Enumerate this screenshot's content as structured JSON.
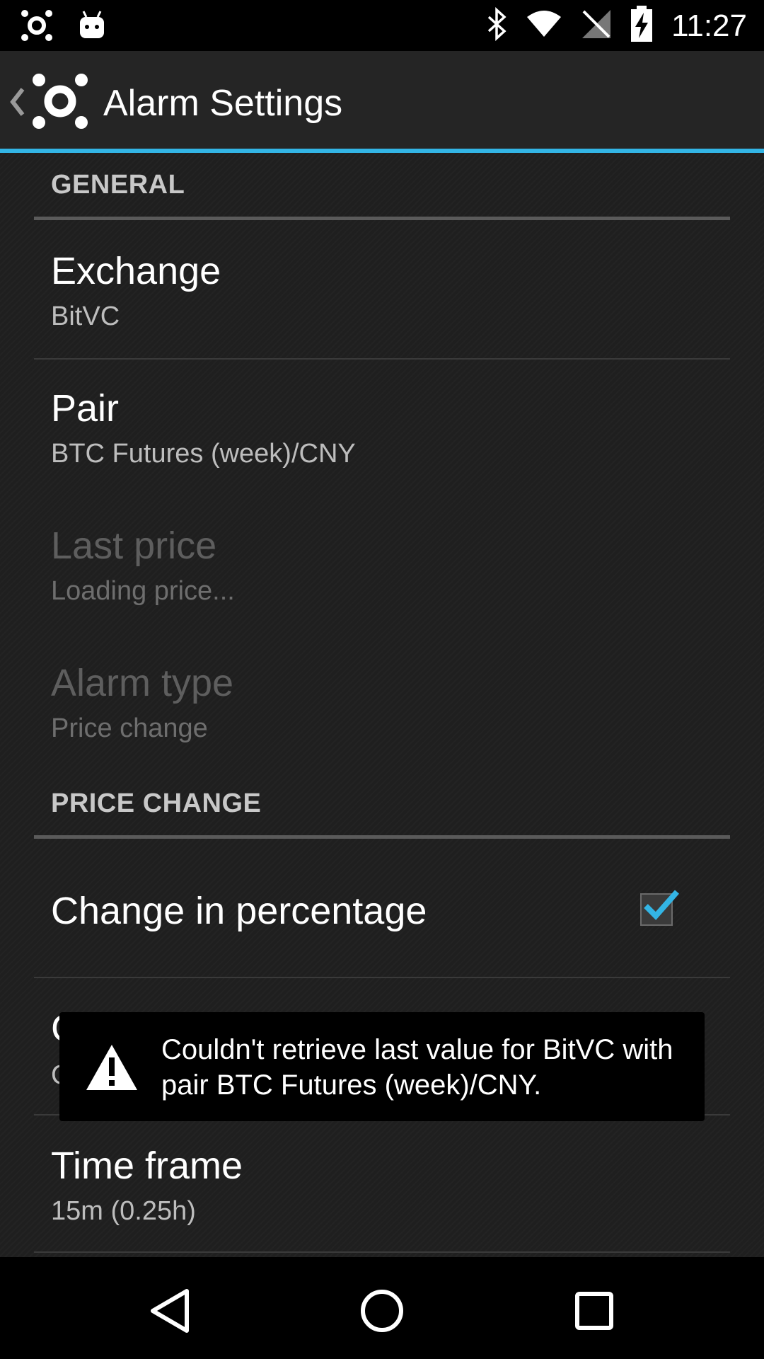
{
  "status_bar": {
    "time": "11:27",
    "icons": [
      "app-notification-icon",
      "android-debug-icon",
      "bluetooth-icon",
      "wifi-icon",
      "no-sim-icon",
      "battery-charging-icon"
    ]
  },
  "action_bar": {
    "title": "Alarm Settings",
    "back_icon": "chevron-left-icon",
    "app_icon": "app-logo-icon",
    "accent_color": "#33b5e5"
  },
  "sections": {
    "general": {
      "header": "GENERAL",
      "items": [
        {
          "title": "Exchange",
          "summary": "BitVC",
          "enabled": true
        },
        {
          "title": "Pair",
          "summary": "BTC Futures (week)/CNY",
          "enabled": true
        },
        {
          "title": "Last price",
          "summary": "Loading price...",
          "enabled": false
        },
        {
          "title": "Alarm type",
          "summary": "Price change",
          "enabled": false
        }
      ]
    },
    "price_change": {
      "header": "PRICE CHANGE",
      "items": [
        {
          "title": "Change in percentage",
          "checked": true
        },
        {
          "title": "C",
          "summary": "C"
        },
        {
          "title": "Time frame",
          "summary": "15m (0.25h)"
        }
      ]
    }
  },
  "toast": {
    "icon": "warning-icon",
    "message": "Couldn't retrieve last value for BitVC with pair BTC Futures (week)/CNY."
  },
  "nav_bar": {
    "buttons": [
      "back-icon",
      "home-icon",
      "recents-icon"
    ]
  }
}
